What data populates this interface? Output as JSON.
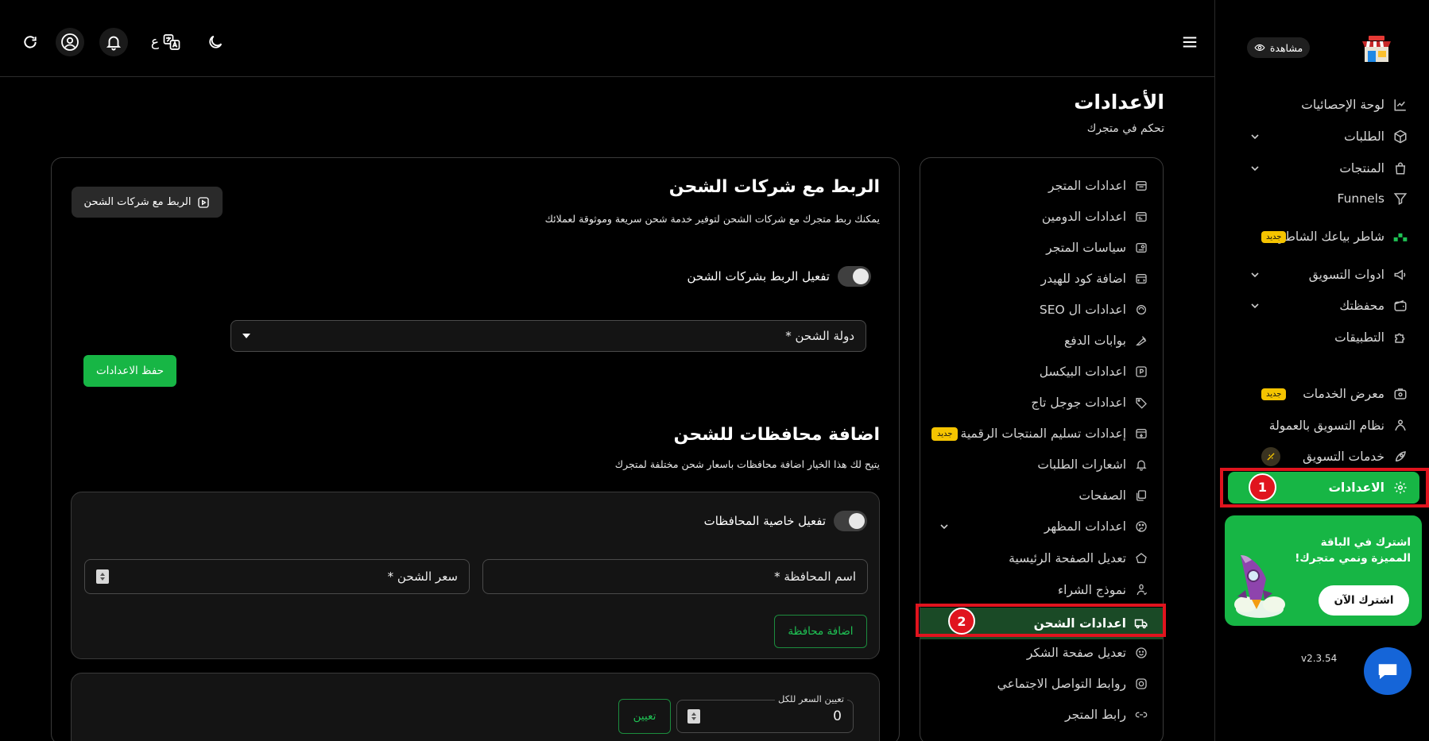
{
  "sidebar": {
    "preview_label": "مشاهدة",
    "items": [
      {
        "label": "لوحة الإحصائيات",
        "icon": "chart-icon"
      },
      {
        "label": "الطلبات",
        "icon": "box-icon"
      },
      {
        "label": "المنتجات",
        "icon": "bag-icon"
      },
      {
        "label": "Funnels",
        "icon": "funnel-icon"
      },
      {
        "label": "شاطر بياعك الشاطر",
        "icon": "shater-icon",
        "badge": "جديد"
      },
      {
        "label": "ادوات التسويق",
        "icon": "megaphone-icon"
      },
      {
        "label": "محفظتك",
        "icon": "wallet-icon"
      },
      {
        "label": "التطبيقات",
        "icon": "puzzle-icon"
      },
      {
        "label": "معرض الخدمات",
        "icon": "gallery-icon",
        "badge": "جديد"
      },
      {
        "label": "نظام التسويق بالعمولة",
        "icon": "commission-icon"
      },
      {
        "label": "خدمات التسويق",
        "icon": "rocket-icon"
      },
      {
        "label": "الاعدادات",
        "icon": "gear-icon",
        "step": "1"
      }
    ],
    "promo": {
      "title": "اشترك في الباقة المميزة ونمي متجرك!",
      "button": "اشترك الآن"
    },
    "version": "v2.3.54"
  },
  "topbar": {
    "lang_label": "ع"
  },
  "page": {
    "title": "الأعدادات",
    "subtitle": "تحكم في متجرك"
  },
  "settings_menu": [
    {
      "label": "اعدادات المتجر",
      "icon": "store-icon"
    },
    {
      "label": "اعدادات الدومين",
      "icon": "domain-icon"
    },
    {
      "label": "سياسات المتجر",
      "icon": "policy-icon"
    },
    {
      "label": "اضافة كود للهيدر",
      "icon": "code-icon"
    },
    {
      "label": "اعدادات ال SEO",
      "icon": "seo-icon"
    },
    {
      "label": "بوابات الدفع",
      "icon": "payment-icon"
    },
    {
      "label": "اعدادات البيكسل",
      "icon": "pixel-icon"
    },
    {
      "label": "اعدادات جوجل تاج",
      "icon": "tag-icon"
    },
    {
      "label": "إعدادات تسليم المنتجات الرقمية",
      "icon": "digital-icon",
      "badge": "جديد"
    },
    {
      "label": "اشعارات الطلبات",
      "icon": "bell-icon"
    },
    {
      "label": "الصفحات",
      "icon": "pages-icon"
    },
    {
      "label": "اعدادات المظهر",
      "icon": "palette-icon"
    },
    {
      "label": "تعديل الصفحة الرئيسية",
      "icon": "home-icon"
    },
    {
      "label": "نموذج الشراء",
      "icon": "form-icon"
    },
    {
      "label": "اعدادات الشحن",
      "icon": "truck-icon",
      "step": "2"
    },
    {
      "label": "تعديل صفحة الشكر",
      "icon": "smile-icon"
    },
    {
      "label": "روابط التواصل الاجتماعي",
      "icon": "instagram-icon"
    },
    {
      "label": "رابط المتجر",
      "icon": "link-icon"
    }
  ],
  "shipping": {
    "title": "الربط مع شركات الشحن",
    "description": "يمكنك ربط متجرك مع شركات الشحن لتوفير خدمة شحن سريعة وموثوقة لعملائك",
    "video_button": "الربط مع شركات الشحن",
    "toggle_label": "تفعيل الربط بشركات الشحن",
    "country_placeholder": "دولة الشحن *",
    "save_button": "حفظ الاعدادات"
  },
  "governorates": {
    "title": "اضافة محافظات للشحن",
    "description": "يتيح لك هذا الخيار اضافة محافظات باسعار شحن مختلفة لمتجرك",
    "toggle_label": "تفعيل خاصية المحافظات",
    "name_placeholder": "اسم المحافظة *",
    "price_placeholder": "سعر الشحن *",
    "add_button": "اضافة محافظة"
  },
  "bulk_price": {
    "label": "تعيين السعر للكل",
    "value": "0",
    "button": "تعيين"
  },
  "colors": {
    "accent": "#17b645",
    "highlight_border": "#e0141e",
    "badge": "#f5c400",
    "chat": "#1565d8"
  }
}
